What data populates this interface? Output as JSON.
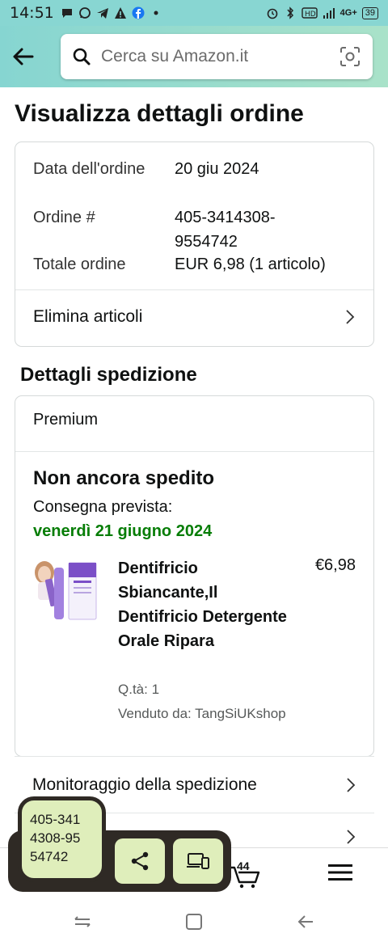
{
  "status_bar": {
    "time": "14:51",
    "battery": "39",
    "icons": [
      "chat-icon",
      "whatsapp-icon",
      "telegram-icon",
      "warning-icon",
      "facebook-icon",
      "dot-icon",
      "alarm-icon",
      "bluetooth-icon",
      "hd-icon",
      "signal-icon",
      "4g-icon"
    ],
    "network": "4G+"
  },
  "header": {
    "search_placeholder": "Cerca su Amazon.it"
  },
  "page": {
    "title": "Visualizza dettagli ordine"
  },
  "summary": {
    "date_label": "Data dell'ordine",
    "date_value": "20 giu 2024",
    "order_label": "Ordine #",
    "order_value": "405-3414308-9554742",
    "total_label": "Totale ordine",
    "total_value": "EUR 6,98 (1 articolo)",
    "remove_items": "Elimina articoli"
  },
  "shipping": {
    "section_title": "Dettagli spedizione",
    "service": "Premium",
    "status": "Non ancora spedito",
    "expected_label": "Consegna prevista:",
    "expected_date": "venerdì 21 giugno 2024",
    "product": {
      "name": "Dentifricio Sbiancante,Il Dentifricio Detergente Orale Ripara",
      "price": "€6,98",
      "qty": "Q.tà: 1",
      "seller": "Venduto da: TangSiUKshop"
    }
  },
  "links": {
    "tracking": "Monitoraggio della spedizione"
  },
  "bottom_nav": {
    "cart_count": "44"
  },
  "overlay": {
    "copied_text": "405-341 4308-95 54742"
  },
  "colors": {
    "header_start": "#86d5d1",
    "header_end": "#a9e2c9",
    "delivery_green": "#067d06",
    "overlay_bg": "#2f2a25",
    "overlay_button": "#dfeebb"
  }
}
